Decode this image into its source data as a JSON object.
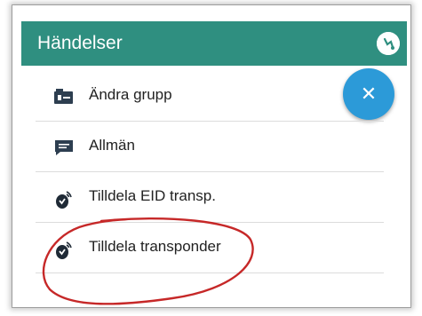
{
  "header": {
    "title": "Händelser",
    "icon": "vet-icon"
  },
  "fab": {
    "icon": "close-icon",
    "glyph": "✕"
  },
  "menu": {
    "items": [
      {
        "label": "Ändra grupp",
        "icon": "group-icon"
      },
      {
        "label": "Allmän",
        "icon": "comment-icon"
      },
      {
        "label": "Tilldela EID transp.",
        "icon": "transponder-icon"
      },
      {
        "label": "Tilldela transponder",
        "icon": "transponder-icon"
      }
    ]
  },
  "colors": {
    "header": "#2f8f80",
    "fab": "#2c9ad8",
    "annotation": "#c62828"
  }
}
